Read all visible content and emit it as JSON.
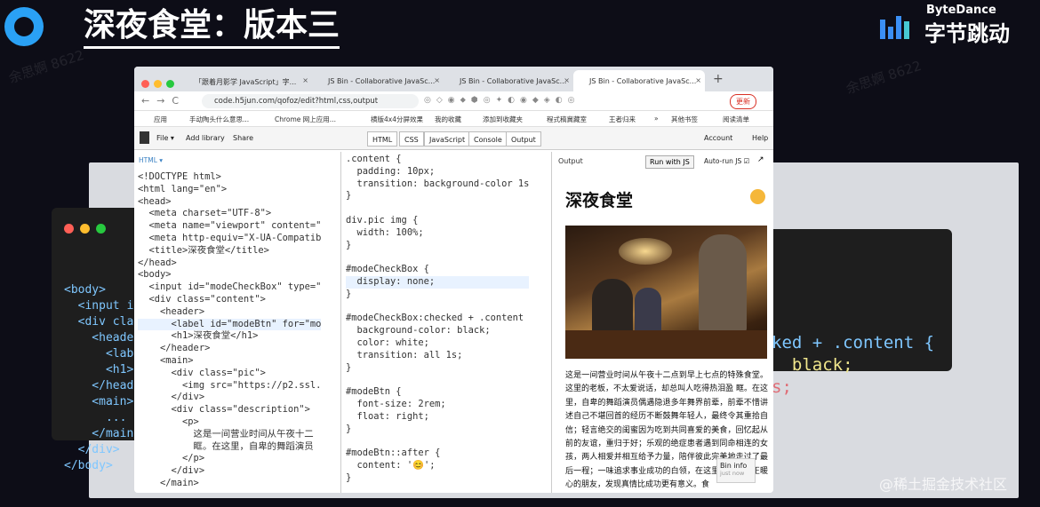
{
  "slide": {
    "title": "深夜食堂：版本三"
  },
  "brand": {
    "en": "ByteDance",
    "cn": "字节跳动"
  },
  "watermark": {
    "text": "余思婀 8622",
    "juejin": "@稀土掘金技术社区"
  },
  "colors": {
    "accent": "#3b8ff5",
    "bg": "#0d0d17"
  },
  "browser": {
    "tabs": [
      {
        "label": "「跟着月影学 JavaScript」字...",
        "active": false
      },
      {
        "label": "JS Bin - Collaborative JavaSc...",
        "active": false
      },
      {
        "label": "JS Bin - Collaborative JavaSc...",
        "active": false
      },
      {
        "label": "JS Bin - Collaborative JavaSc...",
        "active": true
      }
    ],
    "close_glyph": "×",
    "new_tab_glyph": "+",
    "nav_glyphs": "←→C",
    "url": "code.h5jun.com/qofoz/edit?html,css,output",
    "ext_icons": "◎◇◉⬥⬢◎✦◐◉◆◈◐◎",
    "update_label": "更新",
    "bookmarks": [
      "应用",
      "手动陶头什么意思...",
      "Chrome 网上应用...",
      "横版4x4分屏效果",
      "我的收藏",
      "添加到收藏夹",
      "程式稿冀藏室",
      "王者归来",
      "»",
      "其他书签",
      "阅读清单"
    ]
  },
  "jsbin": {
    "file": "File ▾",
    "add_library": "Add library",
    "share": "Share",
    "panels": [
      "HTML",
      "CSS",
      "JavaScript",
      "Console",
      "Output"
    ],
    "account": "Account",
    "help": "Help",
    "html_label": "HTML ▾",
    "html_code": [
      "<!DOCTYPE html>",
      "<html lang=\"en\">",
      "<head>",
      "  <meta charset=\"UTF-8\">",
      "  <meta name=\"viewport\" content=\"",
      "  <meta http-equiv=\"X-UA-Compatib",
      "  <title>深夜食堂</title>",
      "</head>",
      "<body>",
      "  <input id=\"modeCheckBox\" type=\"",
      "  <div class=\"content\">",
      "    <header>",
      "      <label id=\"modeBtn\" for=\"mo",
      "      <h1>深夜食堂</h1>",
      "    </header>",
      "    <main>",
      "      <div class=\"pic\">",
      "        <img src=\"https://p2.ssl.",
      "      </div>",
      "      <div class=\"description\">",
      "        <p>",
      "          这是一间营业时间从午夜十二",
      "          眶。在这里，自卑的舞蹈演员",
      "        </p>",
      "      </div>",
      "    </main>"
    ],
    "css_code": [
      ".content {",
      "  padding: 10px;",
      "  transition: background-color 1s",
      "}",
      "",
      "div.pic img {",
      "  width: 100%;",
      "}",
      "",
      "#modeCheckBox {",
      "  display: none;",
      "}",
      "",
      "#modeCheckBox:checked + .content",
      "  background-color: black;",
      "  color: white;",
      "  transition: all 1s;",
      "}",
      "",
      "#modeBtn {",
      "  font-size: 2rem;",
      "  float: right;",
      "}",
      "",
      "#modeBtn::after {",
      "  content: '😊';",
      "}"
    ],
    "output": {
      "label": "Output",
      "run_label": "Run with JS",
      "autorun_label": "Auto-run JS ☑",
      "expand_glyph": "↗",
      "title": "深夜食堂",
      "description": "这是一间营业时间从午夜十二点到早上七点的特殊食堂。这里的老板，不太爱说话，却总叫人吃得热泪盈 眶。在这里，自卑的舞蹈演员偶遇隐退多年舞界前辈，前辈不惜讲述自己不堪回首的经历不断鼓舞年轻人，最终令其重拾自信；轻言绝交的闺蜜因为吃到共同喜爱的美食，回忆起从前的友谊，重归于好；乐观的绝症患者遇到同命相连的女孩，两人相爱并相互给予力量，陪伴彼此完美地走过了最后一程；一味追求事业成功的白领，在这里结识了真正暖心的朋友，发现真情比成功更有意义。食",
      "bin_info": "Bin info",
      "bin_info_sub": "just now"
    }
  },
  "dark_left_code": [
    "<body>",
    "  <input i",
    "  <div cla",
    "    <heade",
    "      <lab",
    "      <h1>",
    "    </head",
    "    <main>",
    "      ...",
    "    </main",
    "  </div>",
    "</body>"
  ],
  "dark_right_code": [
    "ked + .content {",
    "  black;",
    "",
    "s;"
  ]
}
